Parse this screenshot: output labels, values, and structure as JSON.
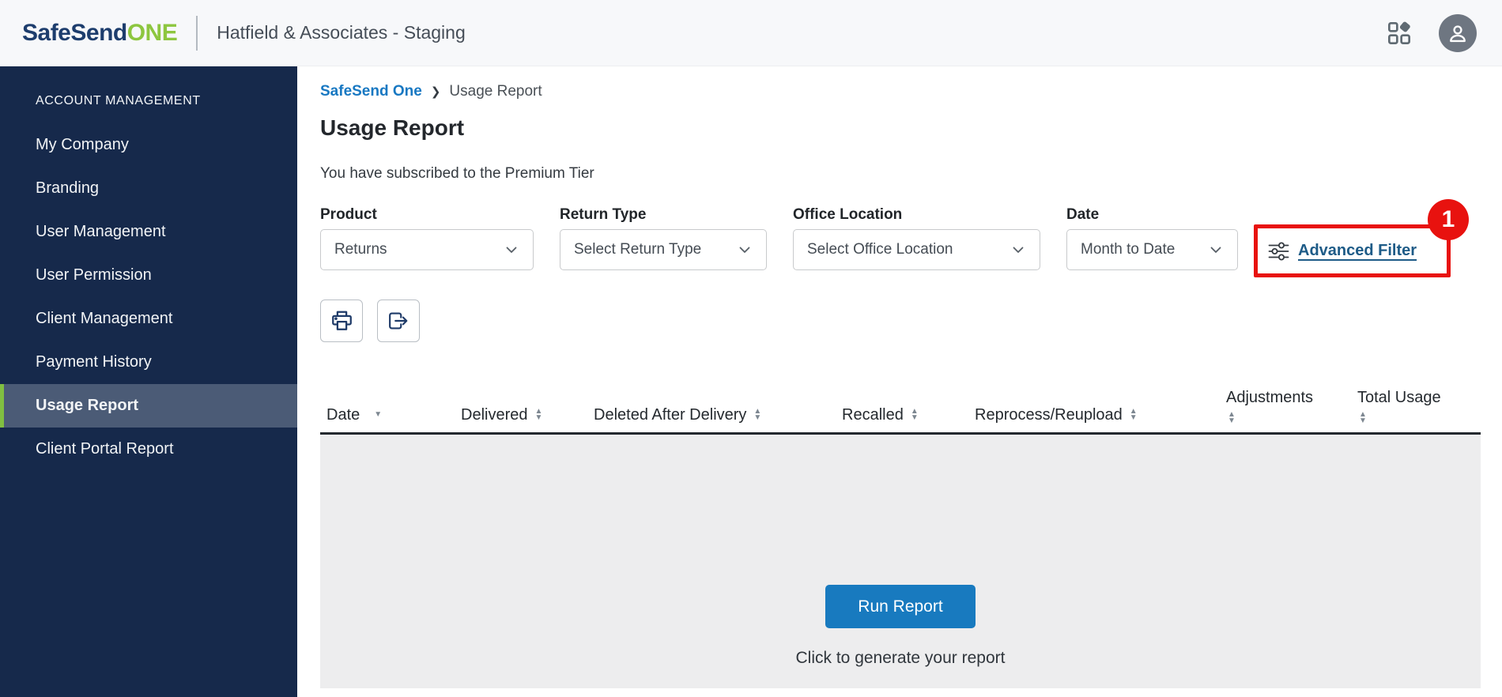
{
  "header": {
    "brand": {
      "part1": "SafeSend",
      "part2": "ONE"
    },
    "account_name": "Hatfield & Associates - Staging",
    "icons": [
      "apps-grid-icon",
      "user-avatar-icon"
    ]
  },
  "sidebar": {
    "section_title": "ACCOUNT MANAGEMENT",
    "items": [
      {
        "label": "My Company",
        "active": false
      },
      {
        "label": "Branding",
        "active": false
      },
      {
        "label": "User Management",
        "active": false
      },
      {
        "label": "User Permission",
        "active": false
      },
      {
        "label": "Client Management",
        "active": false
      },
      {
        "label": "Payment History",
        "active": false
      },
      {
        "label": "Usage Report",
        "active": true
      },
      {
        "label": "Client Portal Report",
        "active": false
      }
    ]
  },
  "breadcrumb": {
    "root": "SafeSend One",
    "current": "Usage Report"
  },
  "page": {
    "title": "Usage Report",
    "subscription_note": "You have subscribed to the Premium Tier"
  },
  "filters": [
    {
      "label": "Product",
      "value": "Returns"
    },
    {
      "label": "Return Type",
      "value": "Select Return Type"
    },
    {
      "label": "Office Location",
      "value": "Select Office Location"
    },
    {
      "label": "Date",
      "value": "Month to Date"
    }
  ],
  "advanced_filter": {
    "label": "Advanced Filter",
    "icon": "sliders-icon"
  },
  "annotation": {
    "badge": "1",
    "color": "#e8120f"
  },
  "toolbar": {
    "icons": [
      "print-icon",
      "export-icon"
    ]
  },
  "table": {
    "columns": [
      {
        "label": "Date",
        "sort": "desc"
      },
      {
        "label": "Delivered",
        "sort": "both"
      },
      {
        "label": "Deleted After Delivery",
        "sort": "both"
      },
      {
        "label": "Recalled",
        "sort": "both"
      },
      {
        "label": "Reprocess/Reupload",
        "sort": "both"
      },
      {
        "label": "Adjustments",
        "sort": "both"
      },
      {
        "label": "Total Usage",
        "sort": "both"
      }
    ],
    "rows": []
  },
  "report": {
    "run_button_label": "Run Report",
    "hint": "Click to generate your report"
  },
  "colors": {
    "brand_navy": "#1d3d6d",
    "brand_green": "#8dc63f",
    "sidebar_bg": "#16294b",
    "sidebar_active_bg": "#4b5b76",
    "sidebar_active_accent": "#80bf41",
    "breadcrumb_link": "#1878c2",
    "advanced_filter_link": "#1d5b87",
    "annotation_red": "#e8120f",
    "run_button_blue": "#187abf",
    "table_empty_bg": "#ededee"
  }
}
